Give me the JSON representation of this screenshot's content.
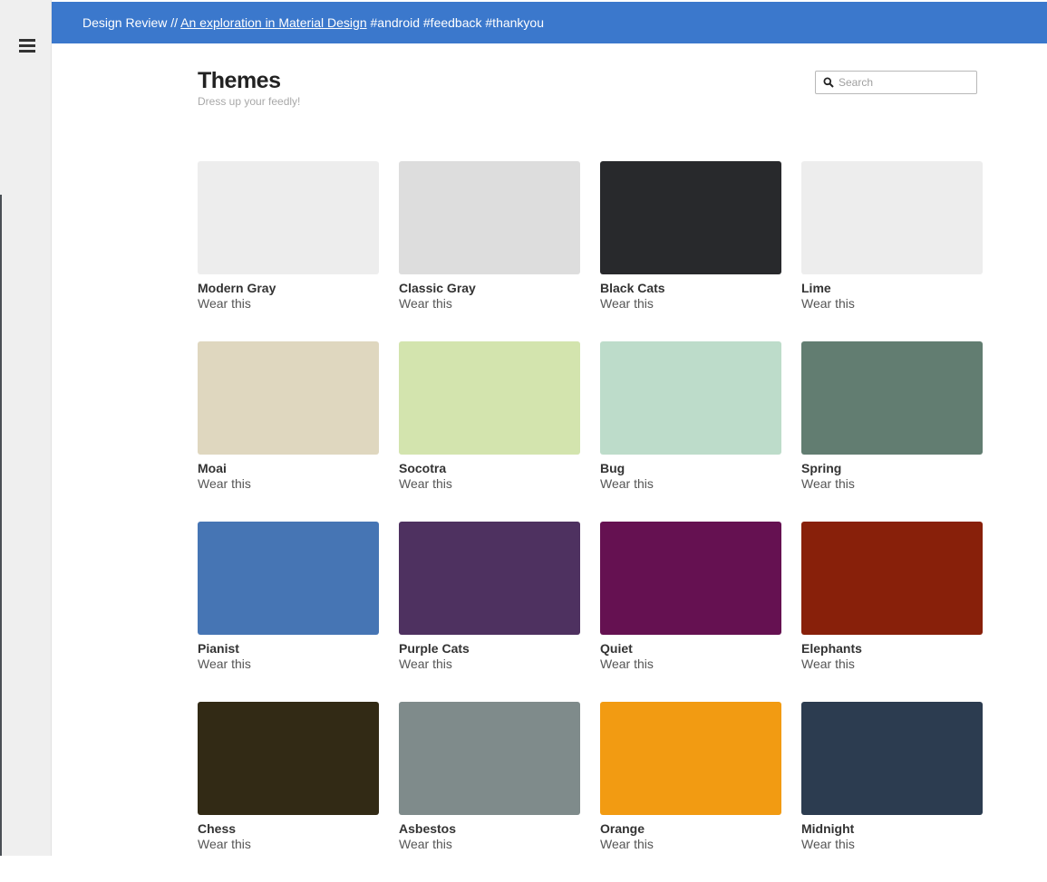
{
  "header": {
    "prefix": "Design Review //",
    "link": "An exploration in Material Design",
    "hashtags": "#android #feedback #thankyou"
  },
  "sidebar": {
    "menu_icon": "hamburger-menu-icon"
  },
  "page": {
    "title": "Themes",
    "subtitle": "Dress up your feedly!"
  },
  "search": {
    "placeholder": "Search",
    "icon": "search-icon"
  },
  "themes": [
    {
      "name": "Modern Gray",
      "action": "Wear this",
      "color": "#ededed"
    },
    {
      "name": "Classic Gray",
      "action": "Wear this",
      "color": "#dddddd"
    },
    {
      "name": "Black Cats",
      "action": "Wear this",
      "color": "#28292c"
    },
    {
      "name": "Lime",
      "action": "Wear this",
      "color": "#ededed"
    },
    {
      "name": "Moai",
      "action": "Wear this",
      "color": "#dfd7bf"
    },
    {
      "name": "Socotra",
      "action": "Wear this",
      "color": "#d3e4ae"
    },
    {
      "name": "Bug",
      "action": "Wear this",
      "color": "#bddcca"
    },
    {
      "name": "Spring",
      "action": "Wear this",
      "color": "#627d71"
    },
    {
      "name": "Pianist",
      "action": "Wear this",
      "color": "#4675b4"
    },
    {
      "name": "Purple Cats",
      "action": "Wear this",
      "color": "#4e3160"
    },
    {
      "name": "Quiet",
      "action": "Wear this",
      "color": "#651151"
    },
    {
      "name": "Elephants",
      "action": "Wear this",
      "color": "#88200a"
    },
    {
      "name": "Chess",
      "action": "Wear this",
      "color": "#322a15"
    },
    {
      "name": "Asbestos",
      "action": "Wear this",
      "color": "#7f8b8b"
    },
    {
      "name": "Orange",
      "action": "Wear this",
      "color": "#f29b12"
    },
    {
      "name": "Midnight",
      "action": "Wear this",
      "color": "#2c3c50"
    }
  ]
}
